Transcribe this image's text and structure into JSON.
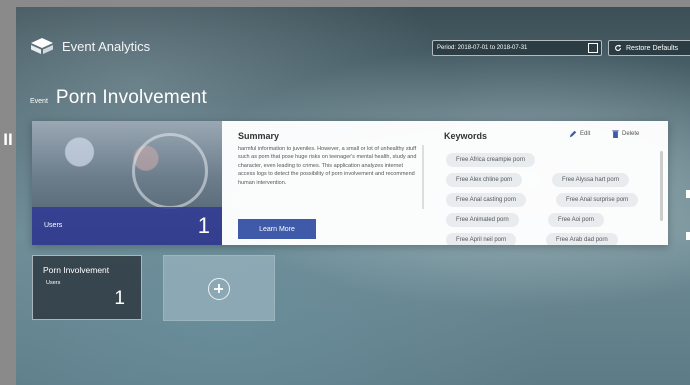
{
  "app": {
    "title": "Event Analytics",
    "logo_icon": "cube-logo-icon"
  },
  "header": {
    "period": "Period: 2018-07-01 to 2018-07-31",
    "restore_label": "Restore Defaults"
  },
  "event": {
    "tag": "Event",
    "name": "Porn Involvement"
  },
  "summary": {
    "title": "Summary",
    "text": "harmful information to juveniles. However, a small or lot of unhealthy stuff such as porn that pose huge risks on teenager's mental health, study and character, even leading to crimes. This application analyzes internet access logs to detect the possibility of porn involvement and recommend human intervention.",
    "learn_more_label": "Learn More",
    "users_label": "Users",
    "users_count": "1"
  },
  "keywords": {
    "title": "Keywords",
    "edit_label": "Edit",
    "delete_label": "Delete",
    "items": [
      "Free Africa creampie porn",
      "Free Alex chline porn",
      "Free Alyssa hart porn",
      "Free Anal casting porn",
      "Free Anal surprise porn",
      "Free Animated porn",
      "Free Aoi porn",
      "Free April neil porn",
      "Free Arab dad porn"
    ]
  },
  "tiles": [
    {
      "title": "Porn Involvement",
      "users_label": "Users",
      "count": "1"
    }
  ],
  "colors": {
    "accent": "#3e5aa8",
    "users_bar": "#303a96"
  }
}
